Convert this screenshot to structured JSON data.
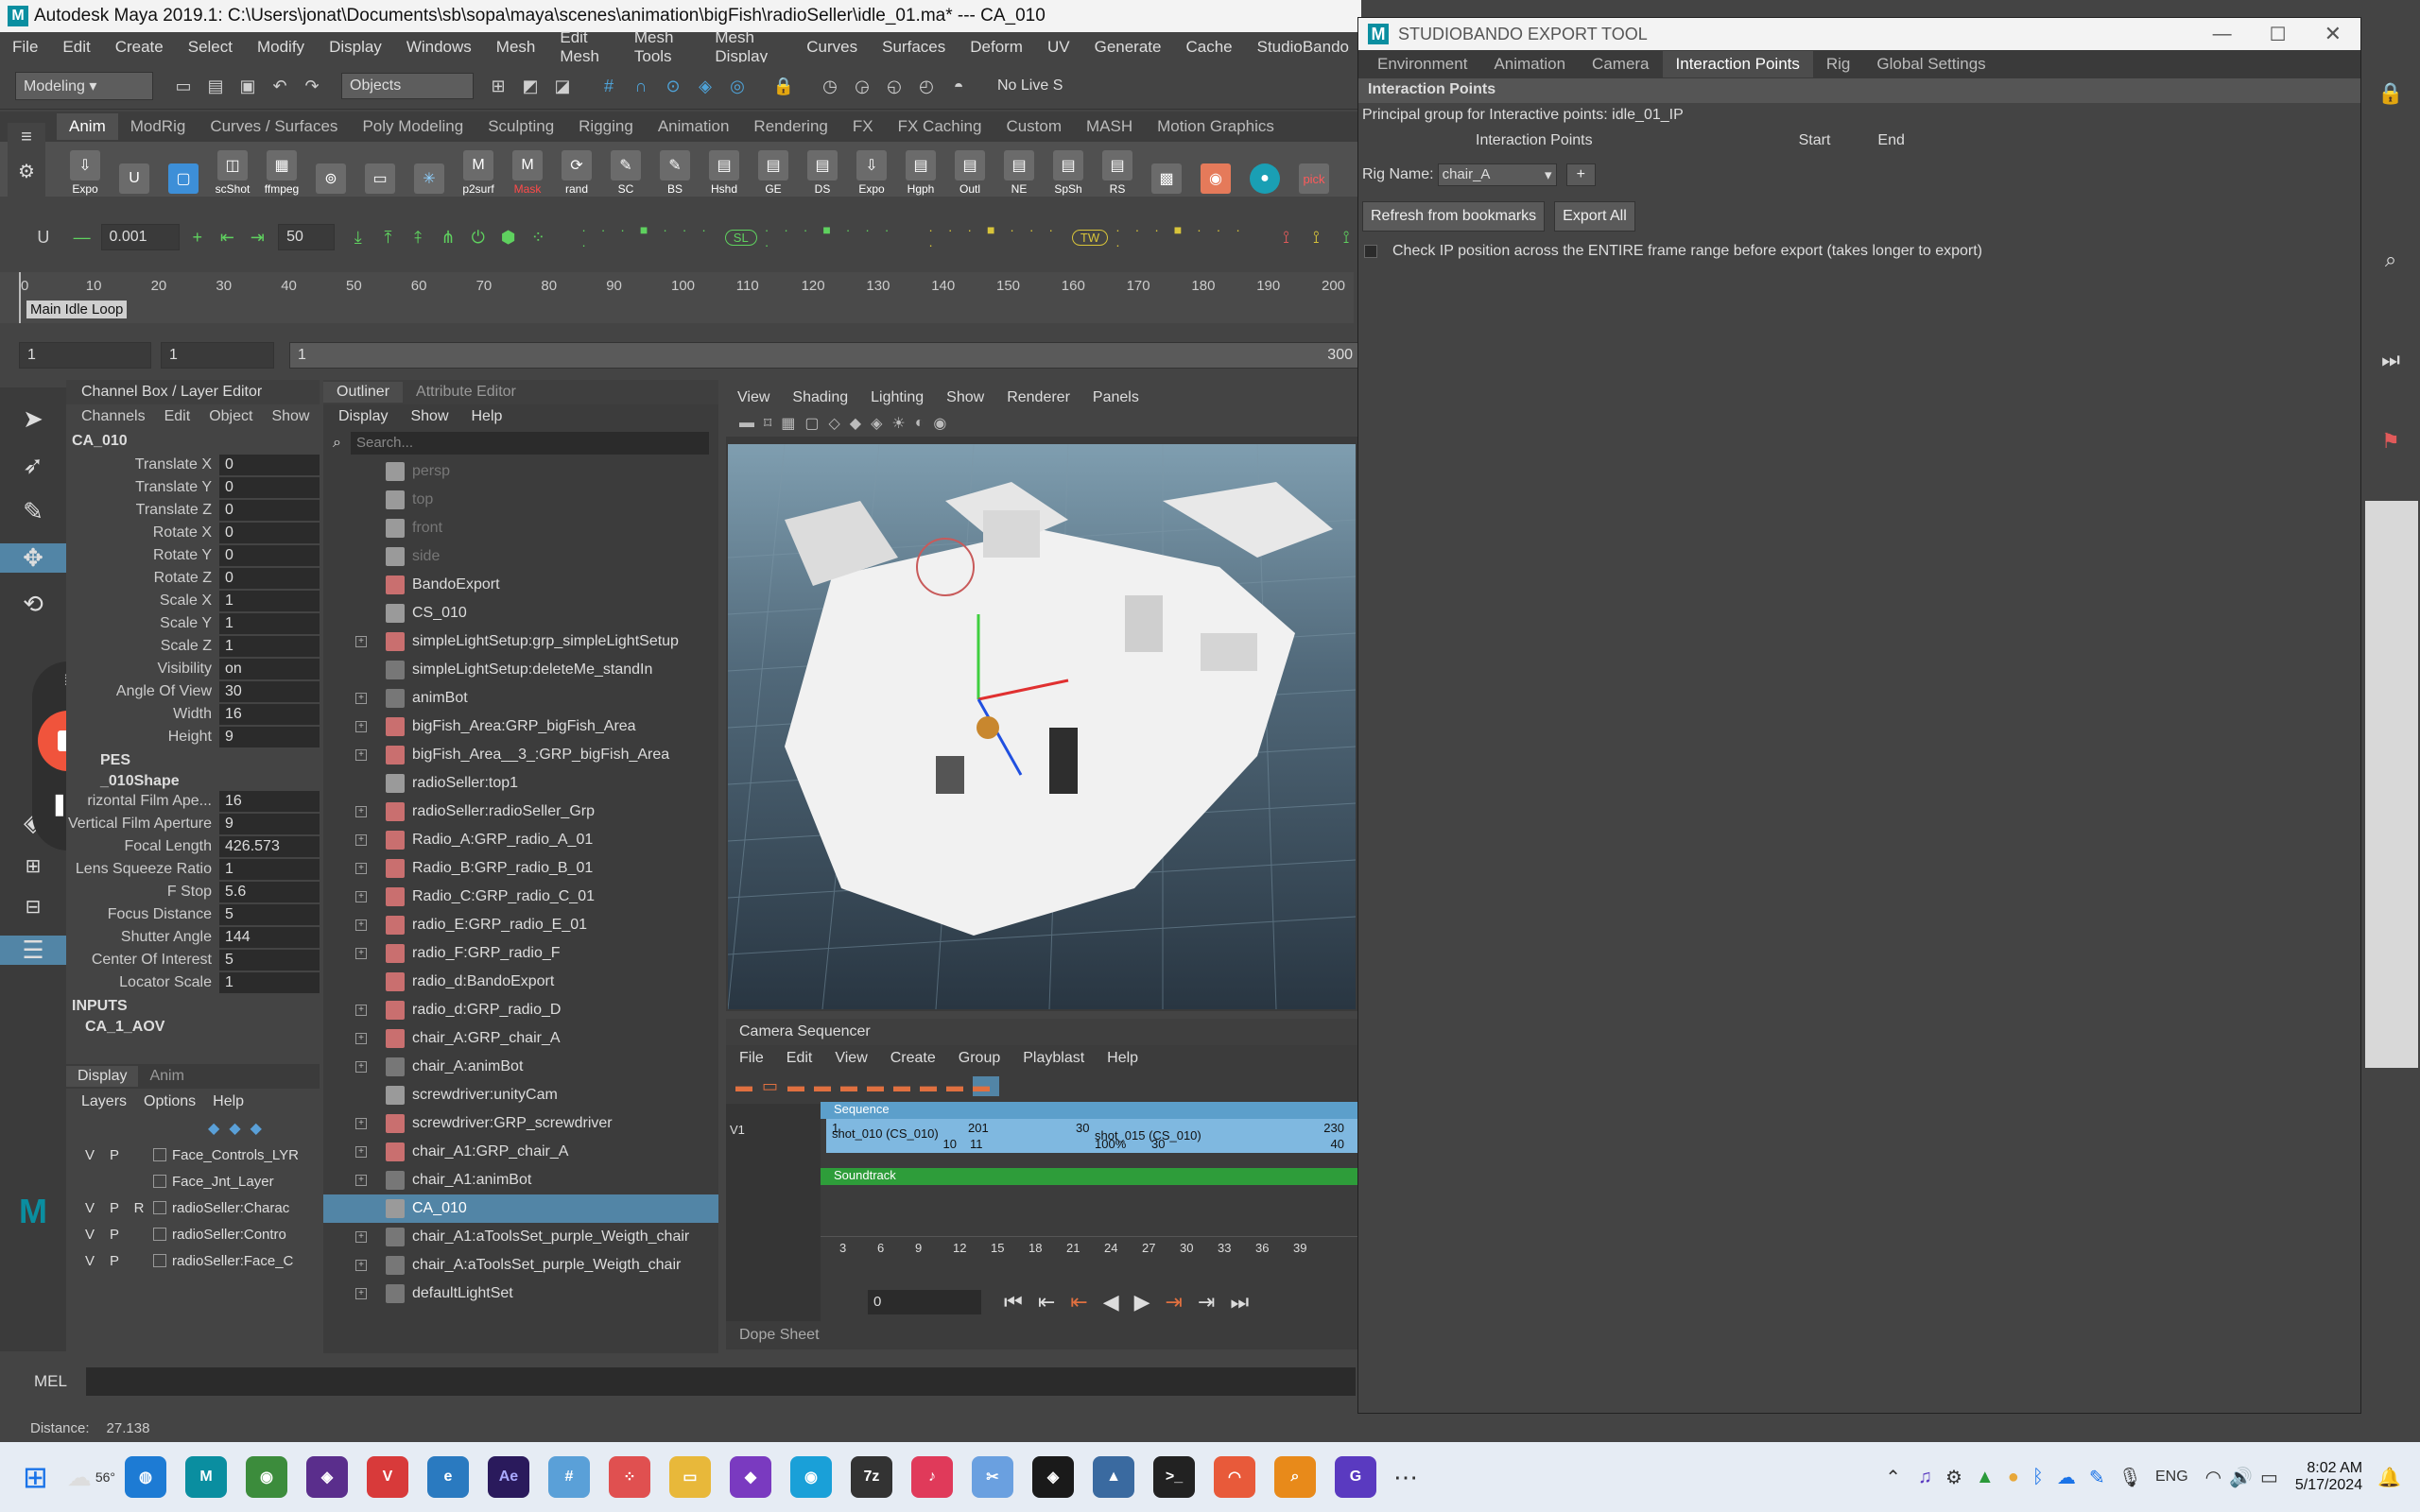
{
  "app": {
    "title": "Autodesk Maya 2019.1: C:\\Users\\jonat\\Documents\\sb\\sopa\\maya\\scenes\\animation\\bigFish\\radioSeller\\idle_01.ma*    ---    CA_010"
  },
  "menu": [
    "File",
    "Edit",
    "Create",
    "Select",
    "Modify",
    "Display",
    "Windows",
    "Mesh",
    "Edit Mesh",
    "Mesh Tools",
    "Mesh Display",
    "Curves",
    "Surfaces",
    "Deform",
    "UV",
    "Generate",
    "Cache",
    "StudioBando"
  ],
  "status": {
    "mode": "Modeling",
    "objects": "Objects",
    "nolive": "No Live S"
  },
  "shelf_tabs": [
    "Anim",
    "ModRig",
    "Curves / Surfaces",
    "Poly Modeling",
    "Sculpting",
    "Rigging",
    "Animation",
    "Rendering",
    "FX",
    "FX Caching",
    "Custom",
    "MASH",
    "Motion Graphics"
  ],
  "shelf_buttons": [
    "Expo",
    "",
    "",
    "scShot",
    "ffmpeg",
    "",
    "",
    "",
    "p2surf",
    "Mask",
    "rand",
    "SC",
    "BS",
    "Hshd",
    "GE",
    "DS",
    "Expo",
    "Hgph",
    "Outl",
    "NE",
    "SpSh",
    "RS",
    "",
    "",
    "",
    "pick"
  ],
  "tools": {
    "value1": "0.001",
    "value2": "50",
    "sl": "SL",
    "tw": "TW"
  },
  "timeline": {
    "ticks": [
      "0",
      "10",
      "20",
      "30",
      "40",
      "50",
      "60",
      "70",
      "80",
      "90",
      "100",
      "110",
      "120",
      "130",
      "140",
      "150",
      "160",
      "170",
      "180",
      "190",
      "200"
    ],
    "bookmark": "Main Idle Loop"
  },
  "range": {
    "start": "1",
    "start2": "1",
    "cur": "1",
    "end": "300"
  },
  "channelbox": {
    "header": "Channel Box / Layer Editor",
    "menus": [
      "Channels",
      "Edit",
      "Object",
      "Show"
    ],
    "object": "CA_010",
    "attrs": [
      {
        "n": "Translate X",
        "v": "0"
      },
      {
        "n": "Translate Y",
        "v": "0"
      },
      {
        "n": "Translate Z",
        "v": "0"
      },
      {
        "n": "Rotate X",
        "v": "0"
      },
      {
        "n": "Rotate Y",
        "v": "0"
      },
      {
        "n": "Rotate Z",
        "v": "0"
      },
      {
        "n": "Scale X",
        "v": "1"
      },
      {
        "n": "Scale Y",
        "v": "1"
      },
      {
        "n": "Scale Z",
        "v": "1"
      },
      {
        "n": "Visibility",
        "v": "on"
      },
      {
        "n": "Angle Of View",
        "v": "30"
      },
      {
        "n": "Width",
        "v": "16"
      },
      {
        "n": "Height",
        "v": "9"
      }
    ],
    "shapes_label": "PES",
    "shape_name": "_010Shape",
    "shape_attrs": [
      {
        "n": "rizontal Film Ape...",
        "v": "16"
      },
      {
        "n": "Vertical Film Aperture",
        "v": "9"
      },
      {
        "n": "Focal Length",
        "v": "426.573"
      },
      {
        "n": "Lens Squeeze Ratio",
        "v": "1"
      },
      {
        "n": "F Stop",
        "v": "5.6"
      },
      {
        "n": "Focus Distance",
        "v": "5"
      },
      {
        "n": "Shutter Angle",
        "v": "144"
      },
      {
        "n": "Center Of Interest",
        "v": "5"
      },
      {
        "n": "Locator Scale",
        "v": "1"
      }
    ],
    "inputs_label": "INPUTS",
    "input_name": "CA_1_AOV",
    "layer_tabs": [
      "Display",
      "Anim"
    ],
    "layer_menus": [
      "Layers",
      "Options",
      "Help"
    ],
    "layers": [
      {
        "v": "V",
        "p": "P",
        "r": "",
        "name": "Face_Controls_LYR"
      },
      {
        "v": "",
        "p": "",
        "r": "",
        "name": "Face_Jnt_Layer"
      },
      {
        "v": "V",
        "p": "P",
        "r": "R",
        "name": "radioSeller:Charac"
      },
      {
        "v": "V",
        "p": "P",
        "r": "",
        "name": "radioSeller:Contro"
      },
      {
        "v": "V",
        "p": "P",
        "r": "",
        "name": "radioSeller:Face_C"
      }
    ]
  },
  "outliner": {
    "tabs": [
      "Outliner",
      "Attribute Editor"
    ],
    "menus": [
      "Display",
      "Show",
      "Help"
    ],
    "search": "Search...",
    "items": [
      {
        "name": "persp",
        "dim": true,
        "type": "cam",
        "exp": false
      },
      {
        "name": "top",
        "dim": true,
        "type": "cam",
        "exp": false
      },
      {
        "name": "front",
        "dim": true,
        "type": "cam",
        "exp": false
      },
      {
        "name": "side",
        "dim": true,
        "type": "cam",
        "exp": false
      },
      {
        "name": "BandoExport",
        "dim": false,
        "type": "grp",
        "exp": false
      },
      {
        "name": "CS_010",
        "dim": false,
        "type": "cam",
        "exp": false
      },
      {
        "name": "simpleLightSetup:grp_simpleLightSetup",
        "dim": false,
        "type": "grp",
        "exp": true
      },
      {
        "name": "simpleLightSetup:deleteMe_standIn",
        "dim": false,
        "type": "mesh",
        "exp": false
      },
      {
        "name": "animBot",
        "dim": false,
        "type": "mesh",
        "exp": true
      },
      {
        "name": "bigFish_Area:GRP_bigFish_Area",
        "dim": false,
        "type": "grp",
        "exp": true
      },
      {
        "name": "bigFish_Area__3_:GRP_bigFish_Area",
        "dim": false,
        "type": "grp",
        "exp": true
      },
      {
        "name": "radioSeller:top1",
        "dim": false,
        "type": "cam",
        "exp": false
      },
      {
        "name": "radioSeller:radioSeller_Grp",
        "dim": false,
        "type": "grp",
        "exp": true
      },
      {
        "name": "Radio_A:GRP_radio_A_01",
        "dim": false,
        "type": "grp",
        "exp": true
      },
      {
        "name": "Radio_B:GRP_radio_B_01",
        "dim": false,
        "type": "grp",
        "exp": true
      },
      {
        "name": "Radio_C:GRP_radio_C_01",
        "dim": false,
        "type": "grp",
        "exp": true
      },
      {
        "name": "radio_E:GRP_radio_E_01",
        "dim": false,
        "type": "grp",
        "exp": true
      },
      {
        "name": "radio_F:GRP_radio_F",
        "dim": false,
        "type": "grp",
        "exp": true
      },
      {
        "name": "radio_d:BandoExport",
        "dim": false,
        "type": "grp",
        "exp": false
      },
      {
        "name": "radio_d:GRP_radio_D",
        "dim": false,
        "type": "grp",
        "exp": true
      },
      {
        "name": "chair_A:GRP_chair_A",
        "dim": false,
        "type": "grp",
        "exp": true
      },
      {
        "name": "chair_A:animBot",
        "dim": false,
        "type": "mesh",
        "exp": true
      },
      {
        "name": "screwdriver:unityCam",
        "dim": false,
        "type": "cam",
        "exp": false
      },
      {
        "name": "screwdriver:GRP_screwdriver",
        "dim": false,
        "type": "grp",
        "exp": true
      },
      {
        "name": "chair_A1:GRP_chair_A",
        "dim": false,
        "type": "grp",
        "exp": true
      },
      {
        "name": "chair_A1:animBot",
        "dim": false,
        "type": "mesh",
        "exp": true
      },
      {
        "name": "CA_010",
        "dim": false,
        "type": "cam",
        "exp": false,
        "sel": true
      },
      {
        "name": "chair_A1:aToolsSet_purple_Weigth_chair",
        "dim": false,
        "type": "mesh",
        "exp": true
      },
      {
        "name": "chair_A:aToolsSet_purple_Weigth_chair",
        "dim": false,
        "type": "mesh",
        "exp": true
      },
      {
        "name": "defaultLightSet",
        "dim": false,
        "type": "mesh",
        "exp": true
      }
    ]
  },
  "viewport": {
    "menus": [
      "View",
      "Shading",
      "Lighting",
      "Show",
      "Renderer",
      "Panels"
    ]
  },
  "camseq": {
    "title": "Camera Sequencer",
    "menus": [
      "File",
      "Edit",
      "View",
      "Create",
      "Group",
      "Playblast",
      "Help"
    ],
    "track_v1": "V1",
    "sequence": "Sequence",
    "shot1": "shot_010 (CS_010)",
    "shot1_start": "1",
    "shot1_end": "201",
    "shot1_b": "10",
    "shot1_c": "11",
    "shot1_d": "30",
    "shot2": "shot_015 (CS_010)",
    "shot2_pct": "100%",
    "shot2_b": "30",
    "shot2_end": "230",
    "shot2_c": "40",
    "soundtrack": "Soundtrack",
    "ticks": [
      "3",
      "6",
      "9",
      "12",
      "15",
      "18",
      "21",
      "24",
      "27",
      "30",
      "33",
      "36",
      "39"
    ],
    "frame": "0",
    "dopesheet": "Dope Sheet"
  },
  "cmd": {
    "label": "MEL"
  },
  "help": {
    "text": "Distance:",
    "value": "27.138"
  },
  "export": {
    "title": "STUDIOBANDO EXPORT TOOL",
    "tabs": [
      "Environment",
      "Animation",
      "Camera",
      "Interaction Points",
      "Rig",
      "Global Settings"
    ],
    "section": "Interaction Points",
    "principal": "Principal group for Interactive points: idle_01_IP",
    "col_ip": "Interaction Points",
    "col_start": "Start",
    "col_end": "End",
    "rig_label": "Rig Name:",
    "rig_value": "chair_A",
    "plus": "+",
    "refresh": "Refresh from bookmarks",
    "export_all": "Export All",
    "check_label": "Check IP position across the ENTIRE frame range before export (takes longer to export)"
  },
  "taskbar": {
    "weather": "56°",
    "lang": "ENG",
    "time": "8:02 AM",
    "date": "5/17/2024"
  },
  "colors": {
    "selection": "#5285a6",
    "maya_teal": "#0a8ea0",
    "record": "#f0543c"
  }
}
